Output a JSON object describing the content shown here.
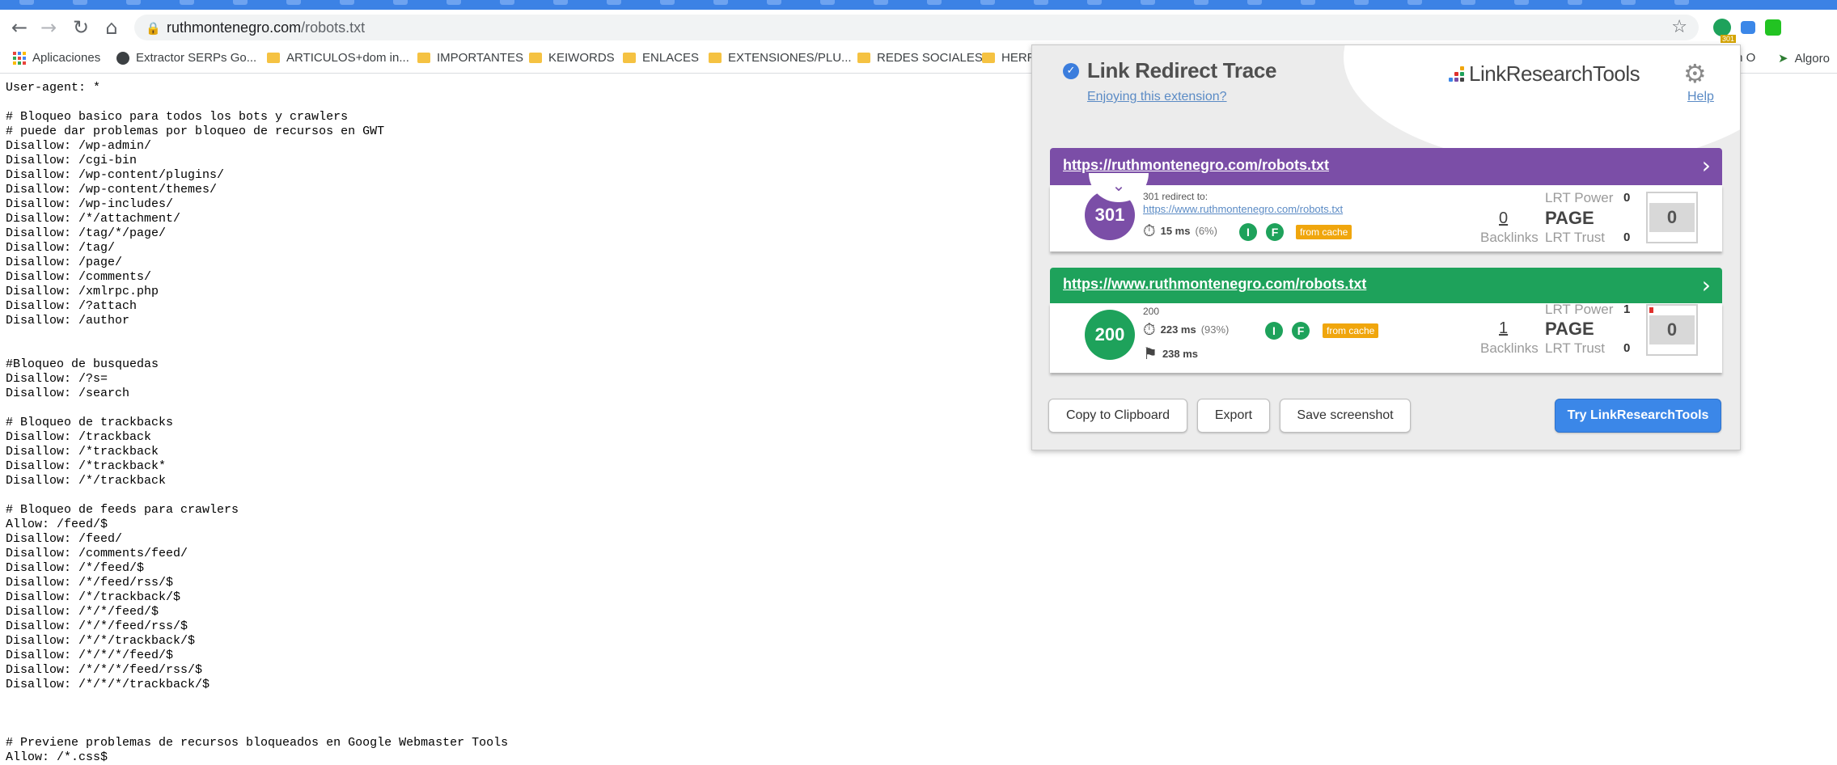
{
  "browser": {
    "url_host": "ruthmontenegro.com",
    "url_path": "/robots.txt",
    "ext_badge": "301"
  },
  "bookmarks": [
    {
      "label": "Aplicaciones",
      "icon": "apps-grid-icon"
    },
    {
      "label": "Extractor SERPs Go...",
      "icon": "globe-icon"
    },
    {
      "label": "ARTICULOS+dom in...",
      "icon": "folder-icon"
    },
    {
      "label": "IMPORTANTES",
      "icon": "folder-icon"
    },
    {
      "label": "KEIWORDS",
      "icon": "folder-icon"
    },
    {
      "label": "ENLACES",
      "icon": "folder-icon"
    },
    {
      "label": "EXTENSIONES/PLU...",
      "icon": "folder-icon"
    },
    {
      "label": "REDES SOCIALES",
      "icon": "folder-icon"
    },
    {
      "label": "HERR",
      "icon": "folder-icon"
    },
    {
      "label": "m O",
      "icon": ""
    },
    {
      "label": "Algoro",
      "icon": "bookmark-icon"
    }
  ],
  "robots_text": "User-agent: *\n\n# Bloqueo basico para todos los bots y crawlers\n# puede dar problemas por bloqueo de recursos en GWT\nDisallow: /wp-admin/\nDisallow: /cgi-bin\nDisallow: /wp-content/plugins/\nDisallow: /wp-content/themes/\nDisallow: /wp-includes/\nDisallow: /*/attachment/\nDisallow: /tag/*/page/\nDisallow: /tag/\nDisallow: /page/\nDisallow: /comments/\nDisallow: /xmlrpc.php\nDisallow: /?attach\nDisallow: /author\n\n\n#Bloqueo de busquedas\nDisallow: /?s=\nDisallow: /search\n\n# Bloqueo de trackbacks\nDisallow: /trackback\nDisallow: /*trackback\nDisallow: /*trackback*\nDisallow: /*/trackback\n\n# Bloqueo de feeds para crawlers\nAllow: /feed/$\nDisallow: /feed/\nDisallow: /comments/feed/\nDisallow: /*/feed/$\nDisallow: /*/feed/rss/$\nDisallow: /*/trackback/$\nDisallow: /*/*/feed/$\nDisallow: /*/*/feed/rss/$\nDisallow: /*/*/trackback/$\nDisallow: /*/*/*/feed/$\nDisallow: /*/*/*/feed/rss/$\nDisallow: /*/*/*/trackback/$\n\n\n\n# Previene problemas de recursos bloqueados en Google Webmaster Tools\nAllow: /*.css$",
  "popup": {
    "title": "Link Redirect Trace",
    "enjoy_link": "Enjoying this extension?",
    "brand": "LinkResearchTools",
    "help": "Help",
    "hops": [
      {
        "url": "https://ruthmontenegro.com/robots.txt",
        "status": "301",
        "status_text": "301 redirect to:",
        "redirect_to": "https://www.ruthmontenegro.com/robots.txt",
        "time": "15 ms",
        "time_pct": "(6%)",
        "cache": "from cache",
        "backlinks": "0",
        "backlinks_label": "Backlinks",
        "lrt_power_label": "LRT Power",
        "lrt_power": "0",
        "page_label": "PAGE",
        "lrt_trust_label": "LRT Trust",
        "lrt_trust": "0",
        "score": "0",
        "color": "#7b4ea7"
      },
      {
        "url": "https://www.ruthmontenegro.com/robots.txt",
        "status": "200",
        "status_text": "200",
        "time": "223 ms",
        "time_pct": "(93%)",
        "total_time": "238 ms",
        "cache": "from cache",
        "backlinks": "1",
        "backlinks_label": "Backlinks",
        "lrt_power_label": "LRT Power",
        "lrt_power": "1",
        "page_label": "PAGE",
        "lrt_trust_label": "LRT Trust",
        "lrt_trust": "0",
        "score": "0",
        "color": "#1ea25b"
      }
    ],
    "buttons": {
      "copy": "Copy to Clipboard",
      "export": "Export",
      "save": "Save screenshot",
      "try": "Try LinkResearchTools"
    }
  }
}
